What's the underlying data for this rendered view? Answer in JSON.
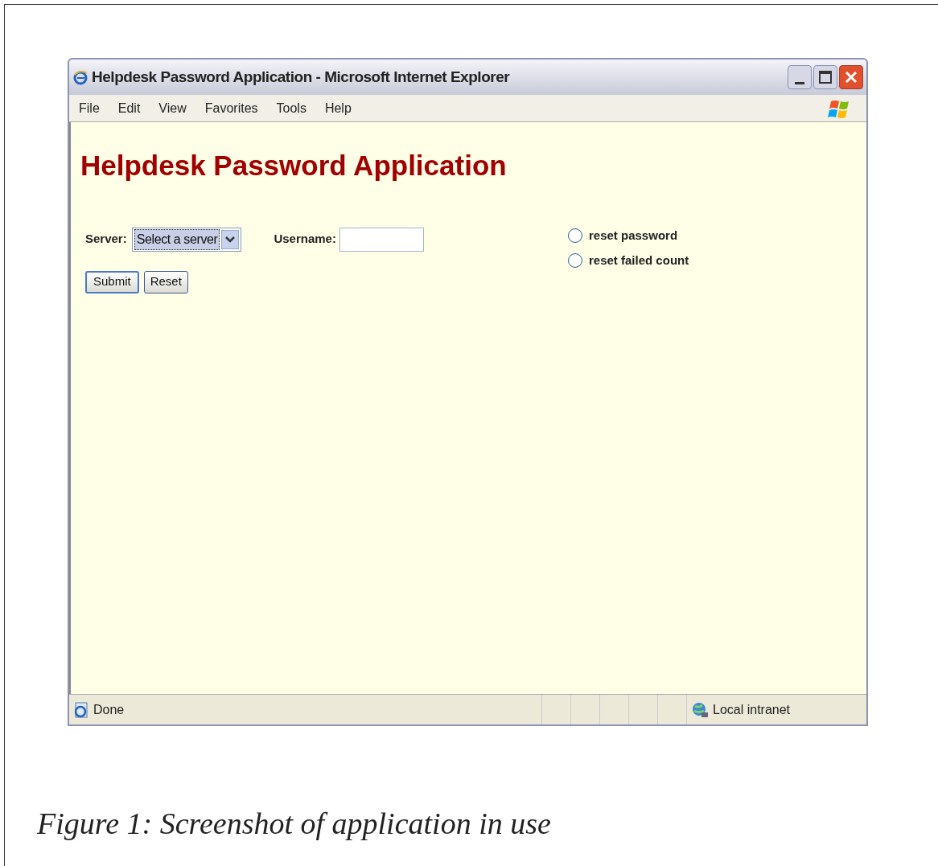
{
  "window": {
    "title": "Helpdesk Password Application - Microsoft Internet Explorer"
  },
  "menu": [
    "File",
    "Edit",
    "View",
    "Favorites",
    "Tools",
    "Help"
  ],
  "page": {
    "heading": "Helpdesk Password Application",
    "server": {
      "label": "Server:",
      "value": "Select a server"
    },
    "username": {
      "label": "Username:"
    },
    "options": [
      {
        "label": "reset password",
        "selected": false
      },
      {
        "label": "reset failed count",
        "selected": false
      }
    ],
    "buttons": [
      "Submit",
      "Reset"
    ]
  },
  "status_bar": {
    "text": "Done",
    "zone": "Local intranet"
  },
  "caption": "Figure 1: Screenshot of application in use"
}
